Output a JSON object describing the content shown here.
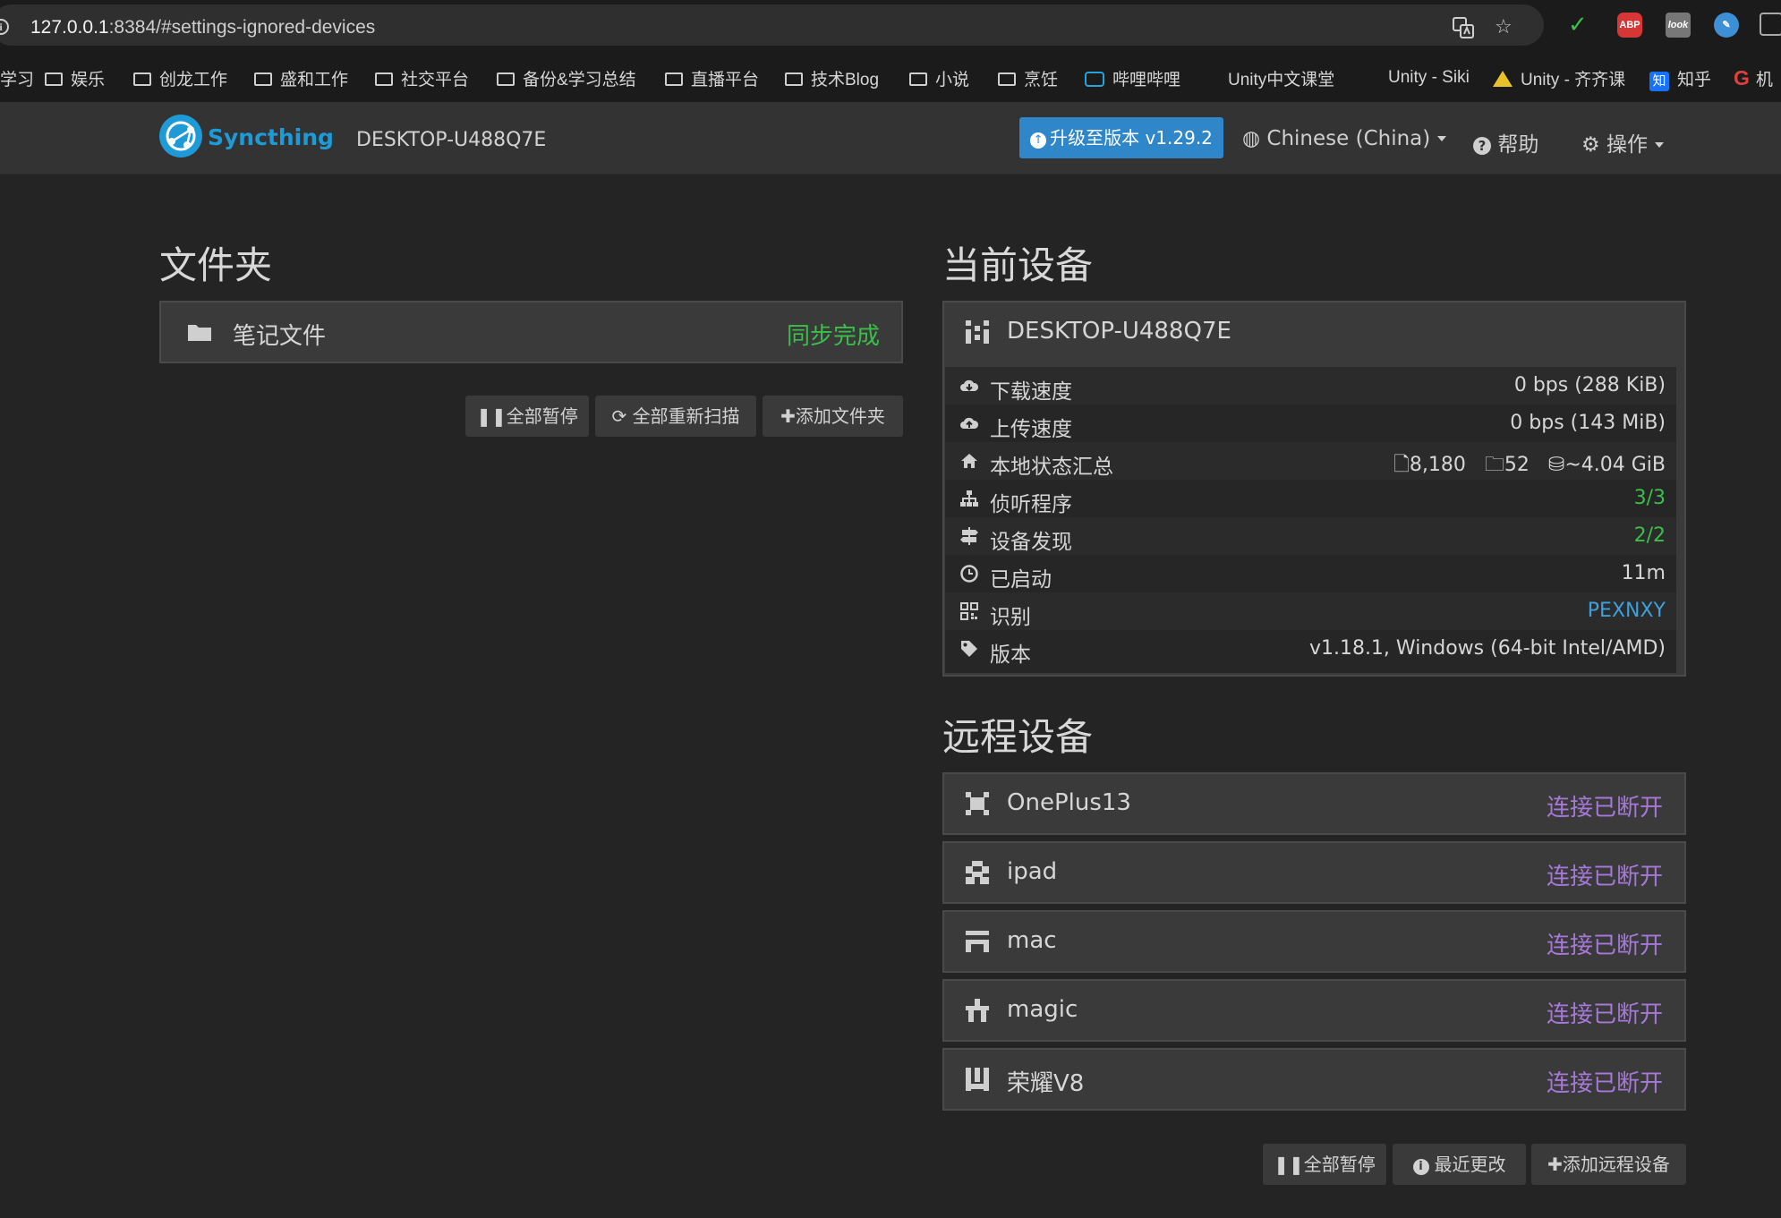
{
  "browser": {
    "url_host": "127.0.0.1",
    "url_rest": ":8384/#settings-ignored-devices",
    "ext_abp": "ABP",
    "ext_look": "look",
    "bookmarks": [
      "学习",
      "娱乐",
      "创龙工作",
      "盛和工作",
      "社交平台",
      "备份&学习总结",
      "直播平台",
      "技术Blog",
      "小说",
      "烹饪",
      "哔哩哔哩",
      "Unity中文课堂",
      "Unity - Siki",
      "Unity - 齐齐课",
      "知乎",
      "机"
    ],
    "zhihu_badge": "知"
  },
  "navbar": {
    "brand": "Syncthing",
    "device_name": "DESKTOP-U488Q7E",
    "upgrade_label": "升级至版本 v1.29.2",
    "language": "Chinese (China)",
    "help": "帮助",
    "actions": "操作"
  },
  "folders": {
    "heading": "文件夹",
    "items": [
      {
        "name": "笔记文件",
        "status": "同步完成"
      }
    ],
    "buttons": {
      "pause_all": "全部暂停",
      "rescan_all": "全部重新扫描",
      "add_folder": "添加文件夹"
    }
  },
  "this_device": {
    "heading": "当前设备",
    "name": "DESKTOP-U488Q7E",
    "rows": {
      "download": {
        "label": "下载速度",
        "value": "0 bps (288 KiB)"
      },
      "upload": {
        "label": "上传速度",
        "value": "0 bps (143 MiB)"
      },
      "local_state": {
        "label": "本地状态汇总",
        "files": "8,180",
        "dirs": "52",
        "size": "~4.04 GiB"
      },
      "listeners": {
        "label": "侦听程序",
        "value": "3/3"
      },
      "discovery": {
        "label": "设备发现",
        "value": "2/2"
      },
      "uptime": {
        "label": "已启动",
        "value": "11m"
      },
      "identification": {
        "label": "识别",
        "value": "PEXNXY"
      },
      "version": {
        "label": "版本",
        "value": "v1.18.1, Windows (64-bit Intel/AMD)"
      }
    }
  },
  "remote_devices": {
    "heading": "远程设备",
    "items": [
      {
        "name": "OnePlus13",
        "status": "连接已断开"
      },
      {
        "name": "ipad",
        "status": "连接已断开"
      },
      {
        "name": "mac",
        "status": "连接已断开"
      },
      {
        "name": "magic",
        "status": "连接已断开"
      },
      {
        "name": "荣耀V8",
        "status": "连接已断开"
      }
    ],
    "buttons": {
      "pause_all": "全部暂停",
      "recent_changes": "最近更改",
      "add_device": "添加远程设备"
    }
  },
  "colors": {
    "brand": "#1e9ad6",
    "success": "#3bbf4a",
    "disconnected": "#a678d8",
    "link": "#3ea0dc",
    "upgrade": "#2f86c8"
  }
}
